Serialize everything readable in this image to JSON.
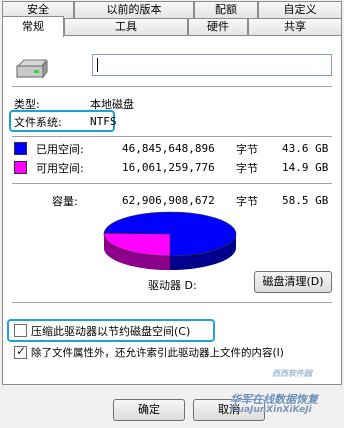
{
  "tabs_row1": [
    {
      "label": "安全"
    },
    {
      "label": "以前的版本"
    },
    {
      "label": "配额"
    },
    {
      "label": "自定义"
    }
  ],
  "tabs_row2": [
    {
      "label": "常规"
    },
    {
      "label": "工具"
    },
    {
      "label": "硬件"
    },
    {
      "label": "共享"
    }
  ],
  "general": {
    "name_value": "",
    "type_label": "类型:",
    "type_value": "本地磁盘",
    "fs_label": "文件系统:",
    "fs_value": "NTFS"
  },
  "space": {
    "used_label": "已用空间:",
    "used_bytes": "46,845,648,896",
    "used_unit": "字节",
    "used_gb": "43.6 GB",
    "free_label": "可用空间:",
    "free_bytes": "16,061,259,776",
    "free_unit": "字节",
    "free_gb": "14.9 GB",
    "cap_label": "容量:",
    "cap_bytes": "62,906,908,672",
    "cap_unit": "字节",
    "cap_gb": "58.5 GB",
    "used_color": "#0000ff",
    "free_color": "#ff00ff",
    "used_fraction": 0.745
  },
  "drive_label": "驱动器 D:",
  "cleanup_button": "磁盘清理(D)",
  "compress_label": "压缩此驱动器以节约磁盘空间(C)",
  "index_label": "除了文件属性外，还允许索引此驱动器上文件的内容(I)",
  "compress_checked": false,
  "index_checked": true,
  "ok_button": "确定",
  "cancel_button": "取消",
  "watermark": {
    "line1": "华军在线数据恢复",
    "line2": "HuaJunXinXiKeJi",
    "logo": "西西软件园"
  },
  "accent_color": "#1fa0d6"
}
